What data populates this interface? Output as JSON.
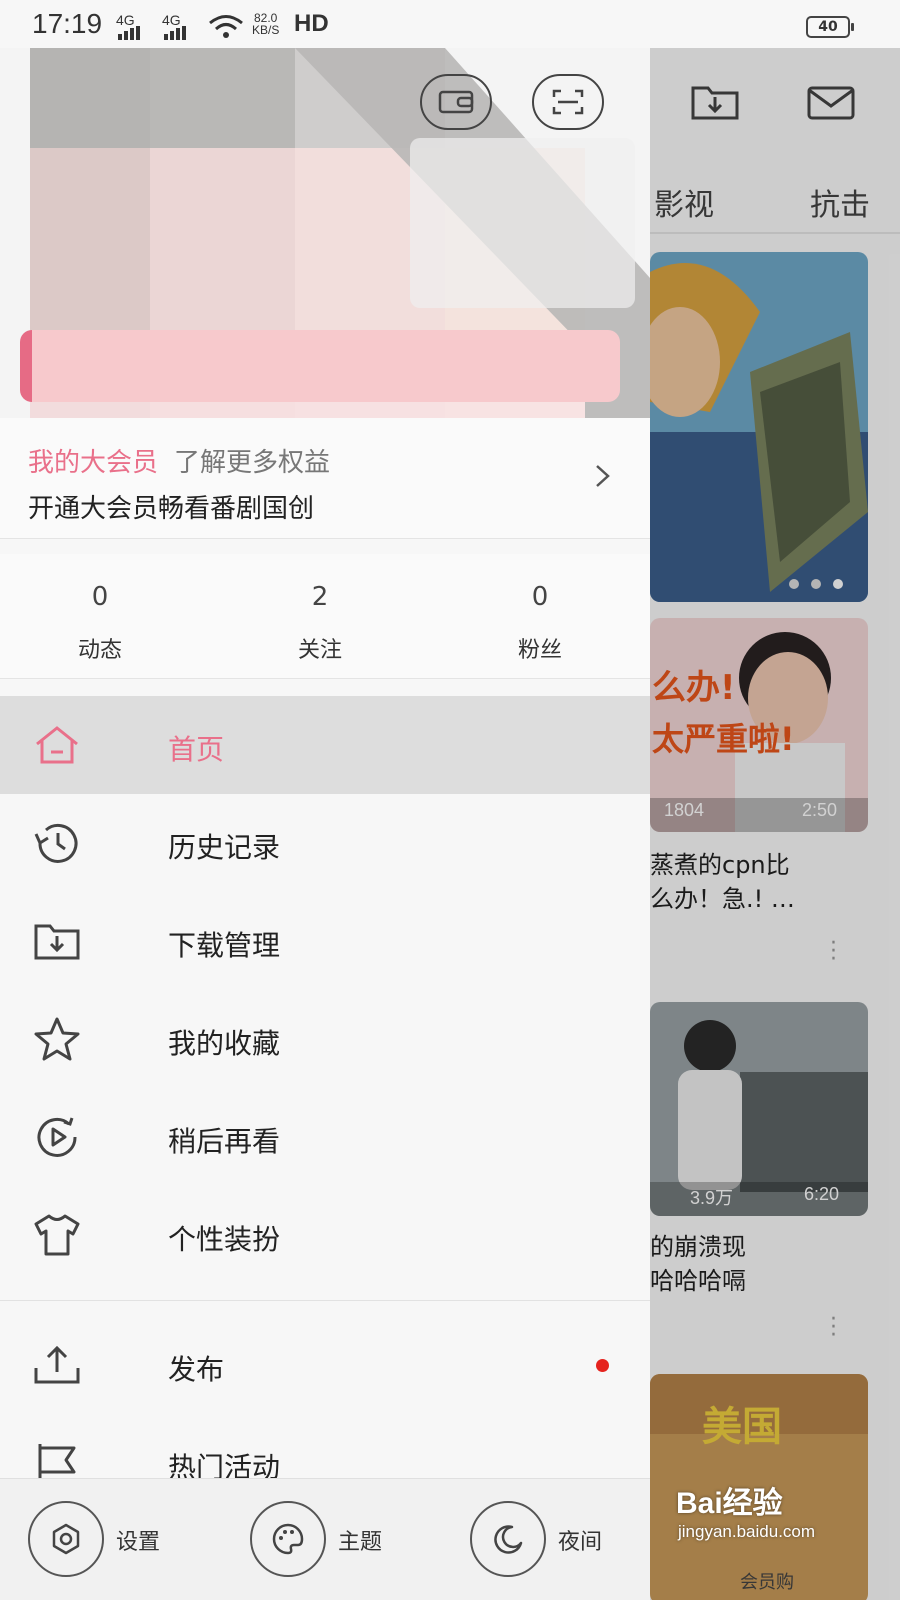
{
  "status_bar": {
    "time": "17:19",
    "network_1": "4G",
    "network_2": "4G",
    "speed_value": "82.0",
    "speed_unit": "KB/S",
    "hd": "HD",
    "battery": "40"
  },
  "drawer": {
    "vip": {
      "title": "我的大会员",
      "more": "了解更多权益",
      "subtitle": "开通大会员畅看番剧国创"
    },
    "stats": [
      {
        "value": "0",
        "label": "动态"
      },
      {
        "value": "2",
        "label": "关注"
      },
      {
        "value": "0",
        "label": "粉丝"
      }
    ],
    "menu": [
      {
        "label": "首页",
        "icon": "home-icon",
        "active": true
      },
      {
        "label": "历史记录",
        "icon": "history-icon"
      },
      {
        "label": "下载管理",
        "icon": "download-folder-icon"
      },
      {
        "label": "我的收藏",
        "icon": "star-icon"
      },
      {
        "label": "稍后再看",
        "icon": "watch-later-icon"
      },
      {
        "label": "个性装扮",
        "icon": "tshirt-icon"
      },
      {
        "label": "发布",
        "icon": "upload-icon",
        "badge": "red-dot"
      },
      {
        "label": "热门活动",
        "icon": "flag-icon"
      }
    ],
    "bottom": [
      {
        "label": "设置",
        "icon": "settings-icon"
      },
      {
        "label": "主题",
        "icon": "palette-icon"
      },
      {
        "label": "夜间",
        "icon": "moon-icon"
      }
    ]
  },
  "feed": {
    "tabs": [
      "影视",
      "抗击"
    ],
    "cards": [
      {
        "views": "1804",
        "duration": "2:50",
        "overlay_1": "么办!",
        "overlay_2": "太严重啦!",
        "title_1": "蒸煮的cpn比",
        "title_2": "么办！急.! …"
      },
      {
        "views": "3.9万",
        "duration": "6:20",
        "title_1": "的崩溃现",
        "title_2": "哈哈哈嗝"
      },
      {
        "overlay_1": "美国",
        "overlay_2": "会员购"
      }
    ]
  },
  "watermark": {
    "logo": "Bai经验",
    "url": "jingyan.baidu.com"
  },
  "colors": {
    "accent_pink": "#e9708a",
    "active_bg": "#dddddd",
    "badge_red": "#e5231e"
  }
}
